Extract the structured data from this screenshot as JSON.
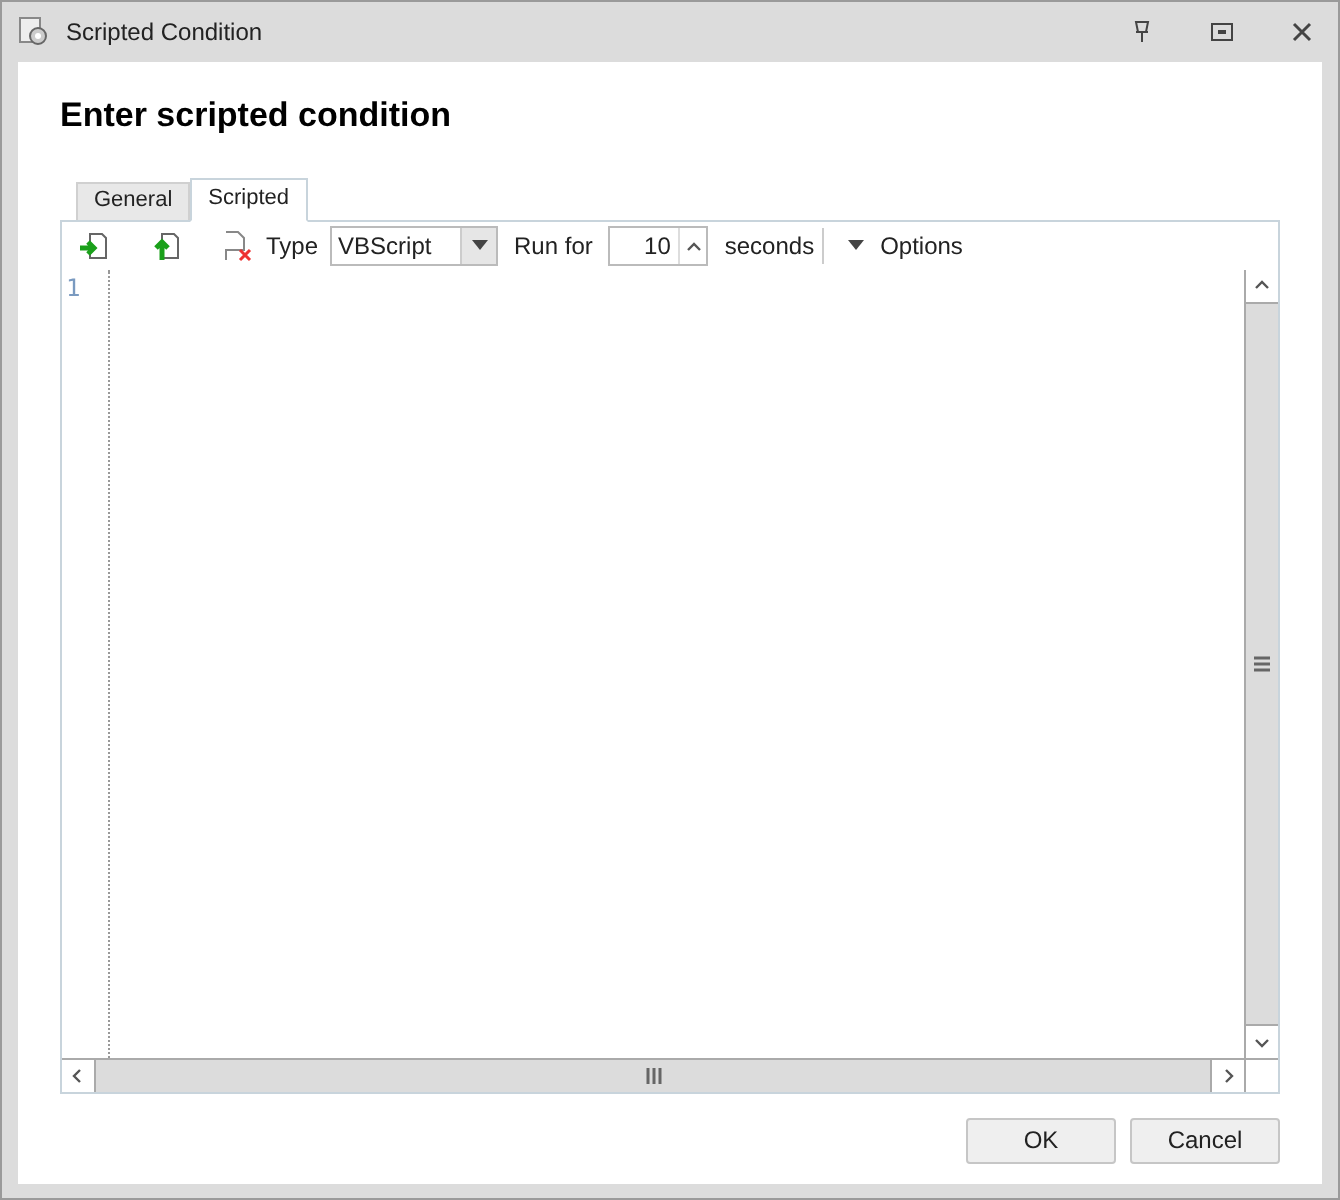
{
  "window": {
    "title": "Scripted Condition"
  },
  "heading": "Enter scripted condition",
  "tabs": [
    {
      "label": "General",
      "selected": false
    },
    {
      "label": "Scripted",
      "selected": true
    }
  ],
  "toolbar": {
    "type_label": "Type",
    "type_value": "VBScript",
    "run_label": "Run for",
    "run_value": "10",
    "seconds_label": "seconds",
    "options_label": "Options"
  },
  "editor": {
    "line_numbers": [
      "1"
    ]
  },
  "buttons": [
    "OK",
    "Cancel"
  ]
}
